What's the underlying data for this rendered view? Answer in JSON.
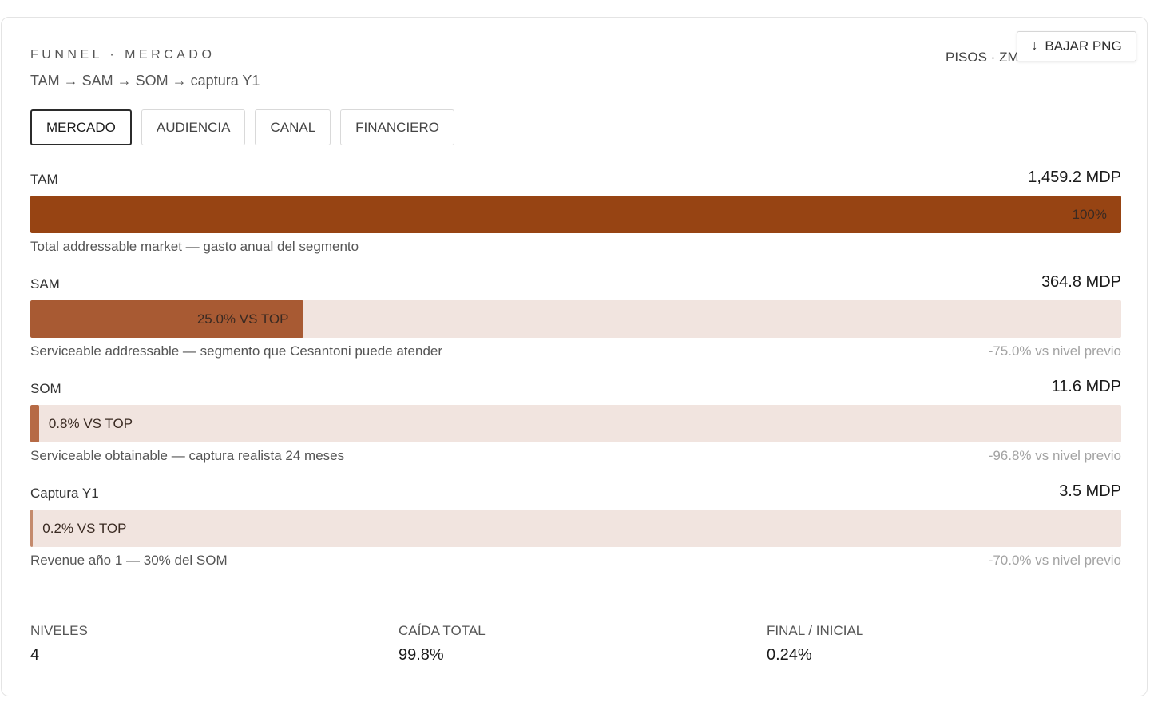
{
  "header": {
    "eyebrow": "FUNNEL · MERCADO",
    "subtitle": "TAM → SAM → SOM → captura Y1",
    "context": "PISOS · ZM",
    "download_label": "BAJAR PNG"
  },
  "tabs": [
    {
      "label": "MERCADO",
      "active": true
    },
    {
      "label": "AUDIENCIA",
      "active": false
    },
    {
      "label": "CANAL",
      "active": false
    },
    {
      "label": "FINANCIERO",
      "active": false
    }
  ],
  "chart_data": {
    "type": "bar",
    "unit": "MDP",
    "categories": [
      "TAM",
      "SAM",
      "SOM",
      "Captura Y1"
    ],
    "values": [
      1459.2,
      364.8,
      11.6,
      3.5
    ],
    "levels": [
      {
        "name": "TAM",
        "value": 1459.2,
        "value_label": "1,459.2 MDP",
        "pct_of_top": 100,
        "pct_label": "100%",
        "description": "Total addressable market — gasto anual del segmento",
        "delta_label": "",
        "color": "#974413"
      },
      {
        "name": "SAM",
        "value": 364.8,
        "value_label": "364.8 MDP",
        "pct_of_top": 25.0,
        "pct_label": "25.0% VS TOP",
        "description": "Serviceable addressable — segmento que Cesantoni puede atender",
        "delta_label": "-75.0% vs nivel previo",
        "color": "#a85a33"
      },
      {
        "name": "SOM",
        "value": 11.6,
        "value_label": "11.6 MDP",
        "pct_of_top": 0.8,
        "pct_label": "0.8% VS TOP",
        "description": "Serviceable obtainable — captura realista 24 meses",
        "delta_label": "-96.8% vs nivel previo",
        "color": "#b66a45"
      },
      {
        "name": "Captura Y1",
        "value": 3.5,
        "value_label": "3.5 MDP",
        "pct_of_top": 0.2,
        "pct_label": "0.2% VS TOP",
        "description": "Revenue año 1 — 30% del SOM",
        "delta_label": "-70.0% vs nivel previo",
        "color": "#c48a6c"
      }
    ],
    "track_color": "#f1e4df"
  },
  "summary": [
    {
      "label": "NIVELES",
      "value": "4"
    },
    {
      "label": "CAÍDA TOTAL",
      "value": "99.8%"
    },
    {
      "label": "FINAL / INICIAL",
      "value": "0.24%"
    }
  ]
}
